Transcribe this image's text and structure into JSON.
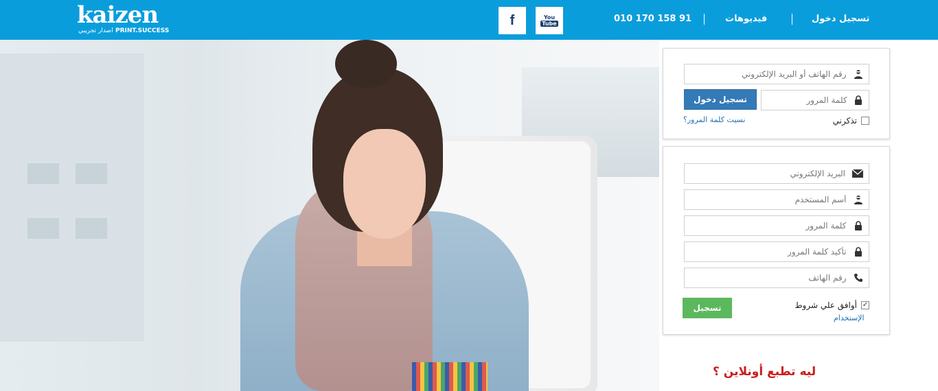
{
  "header": {
    "logo_word": "kaizen",
    "logo_sub": "PRINT.SUCCESS",
    "logo_tag": "اصدار تجريبي",
    "phone": "010 170 158 91",
    "videos_label": "فيديوهات",
    "login_label": "تسجيل دخول",
    "social": {
      "facebook_glyph": "f",
      "youtube_you": "You",
      "youtube_tube": "Tube"
    }
  },
  "login_form": {
    "identifier_placeholder": "رقم الهاتف أو البريد الإلكتروني",
    "password_placeholder": "كلمة المرور",
    "submit_label": "تسجيل دخول",
    "remember_label": "تذكرني",
    "remember_checked": false,
    "forgot_label": "نسيت كلمة المرور؟"
  },
  "register_form": {
    "email_placeholder": "البريد الإلكتروني",
    "username_placeholder": "أسم المستخدم",
    "password_placeholder": "كلمة المرور",
    "confirm_password_placeholder": "تأكيد كلمة المرور",
    "phone_placeholder": "رقم الهاتف",
    "terms_label": "أوافق علي شروط",
    "terms_link": "الإستخدام",
    "terms_checked": true,
    "submit_label": "تسجيل"
  },
  "tagline": "ليه تطبع أونلاين ؟",
  "colors": {
    "header_bg": "#0a9ddc",
    "login_button": "#337ab7",
    "register_button": "#5cb85c",
    "tagline": "#cc1d1d",
    "link": "#1f6fb2"
  },
  "icons": {
    "identifier": "user-icon",
    "password": "lock-icon",
    "email": "envelope-icon",
    "phone": "phone-icon"
  }
}
